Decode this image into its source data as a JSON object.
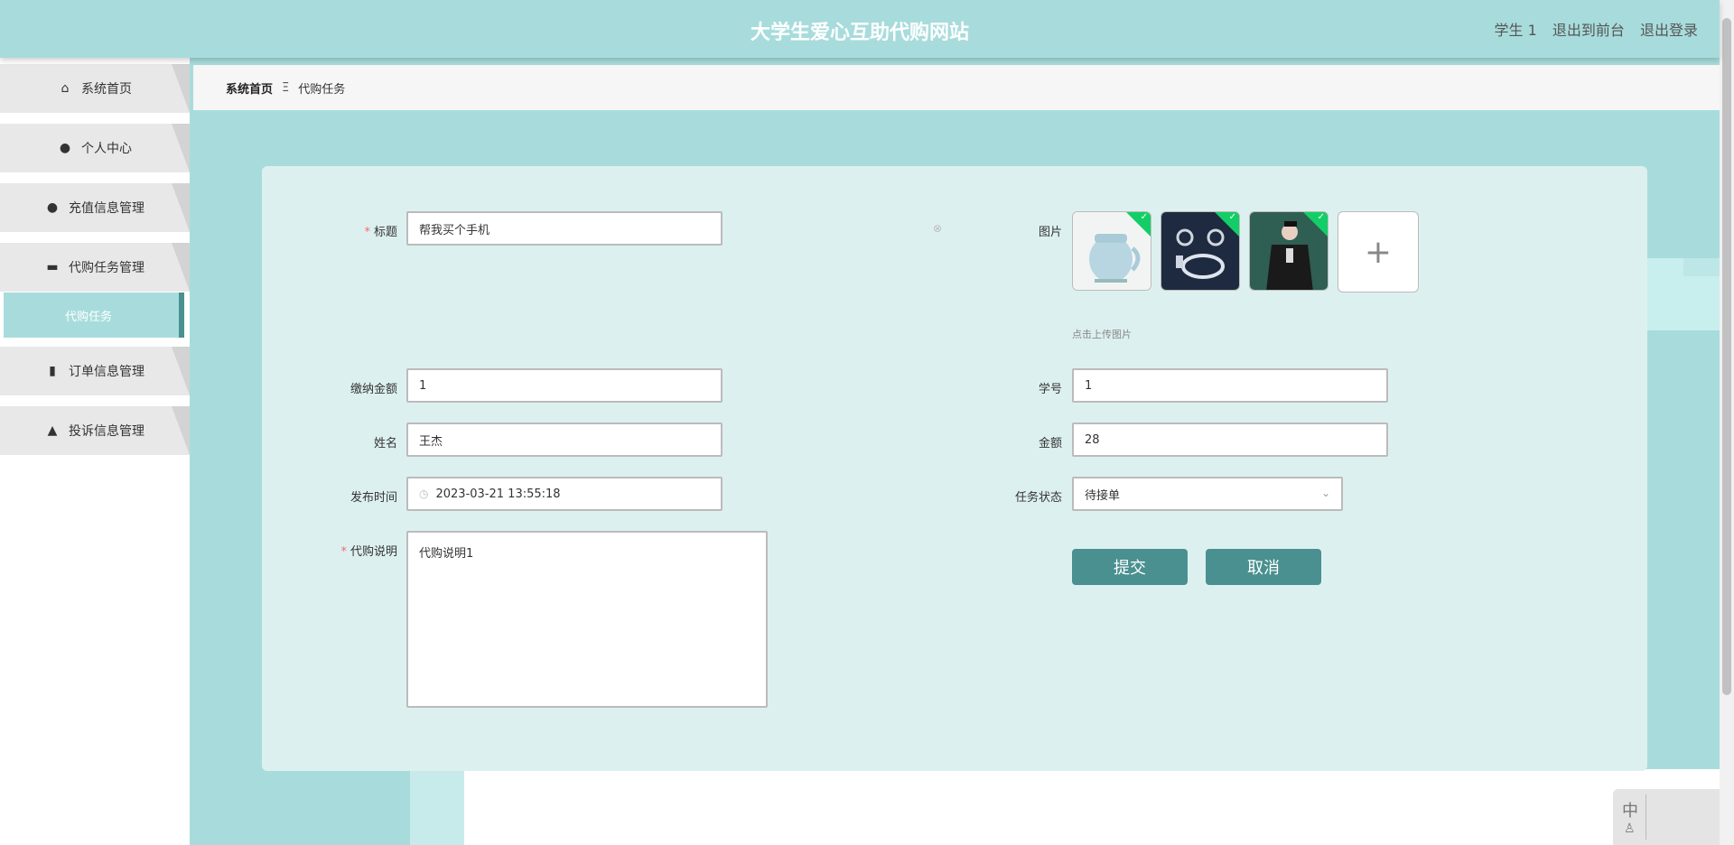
{
  "header": {
    "title": "大学生爱心互助代购网站",
    "user": "学生 1",
    "to_front": "退出到前台",
    "logout": "退出登录"
  },
  "sidebar": {
    "items": [
      {
        "label": "系统首页",
        "icon": "home-icon"
      },
      {
        "label": "个人中心",
        "icon": "person-icon"
      },
      {
        "label": "充值信息管理",
        "icon": "balloon-icon"
      },
      {
        "label": "代购任务管理",
        "icon": "drawer-icon"
      },
      {
        "label": "订单信息管理",
        "icon": "bar-chart-icon"
      },
      {
        "label": "投诉信息管理",
        "icon": "user-icon"
      }
    ],
    "sub_active": "代购任务"
  },
  "breadcrumb": {
    "home": "系统首页",
    "sep": "Ξ",
    "current": "代购任务"
  },
  "form": {
    "title_label": "标题",
    "title_value": "帮我买个手机",
    "pay_label": "缴纳金额",
    "pay_value": "1",
    "name_label": "姓名",
    "name_value": "王杰",
    "time_label": "发布时间",
    "time_value": "2023-03-21 13:55:18",
    "desc_label": "代购说明",
    "desc_value": "代购说明1",
    "image_label": "图片",
    "upload_hint": "点击上传图片",
    "student_no_label": "学号",
    "student_no_value": "1",
    "amount_label": "金额",
    "amount_value": "28",
    "status_label": "任务状态",
    "status_value": "待接单",
    "submit": "提交",
    "cancel": "取消"
  },
  "ime": {
    "lang": "中"
  },
  "colors": {
    "header_bg": "#a8dcdc",
    "panel_bg": "#ddf0f0",
    "button": "#4a9090",
    "required": "#f56c6c"
  }
}
